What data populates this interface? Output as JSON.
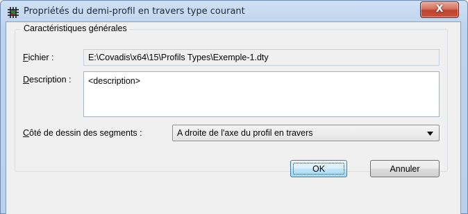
{
  "window": {
    "title": "Propriétés du demi-profil en travers type courant",
    "close_glyph": "X"
  },
  "group": {
    "legend": "Caractéristiques générales"
  },
  "file": {
    "label_accel": "F",
    "label_rest": "ichier :",
    "value": "E:\\Covadis\\x64\\15\\Profils Types\\Exemple-1.dty"
  },
  "description": {
    "label_accel": "D",
    "label_rest": "escription :",
    "value": "<description>"
  },
  "segments_side": {
    "label_accel": "C",
    "label_rest": "ôté de dessin des segments :",
    "selected": "A droite de l'axe du profil en travers"
  },
  "buttons": {
    "ok": "OK",
    "cancel": "Annuler"
  },
  "colors": {
    "title_bar": "#bcd3ee",
    "dialog_background": "#f0f0f0",
    "close_button": "#c8533d",
    "default_button_border": "#3c7fb1"
  },
  "icons": {
    "app": "grid-hash-icon",
    "close": "close-icon",
    "dropdown": "chevron-down-icon"
  }
}
